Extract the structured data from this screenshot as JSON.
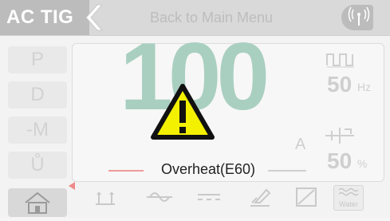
{
  "header": {
    "mode_label": "AC TIG",
    "back_label": "Back to Main Menu"
  },
  "sidebar": {
    "items": [
      {
        "label": "P"
      },
      {
        "label": "D"
      },
      {
        "label": "-M"
      },
      {
        "label": "Ů"
      }
    ]
  },
  "main": {
    "current_value": "100",
    "current_unit": "A",
    "frequency": {
      "value": "50",
      "unit": "Hz"
    },
    "balance": {
      "value": "50",
      "unit": "%"
    },
    "error_text": "Overheat(E60)"
  },
  "toolbar": {
    "water_label": "Water"
  },
  "colors": {
    "accent_green": "#a9cfc0",
    "warning_yellow": "#f3f000",
    "indicator_red": "#f08a8a"
  }
}
